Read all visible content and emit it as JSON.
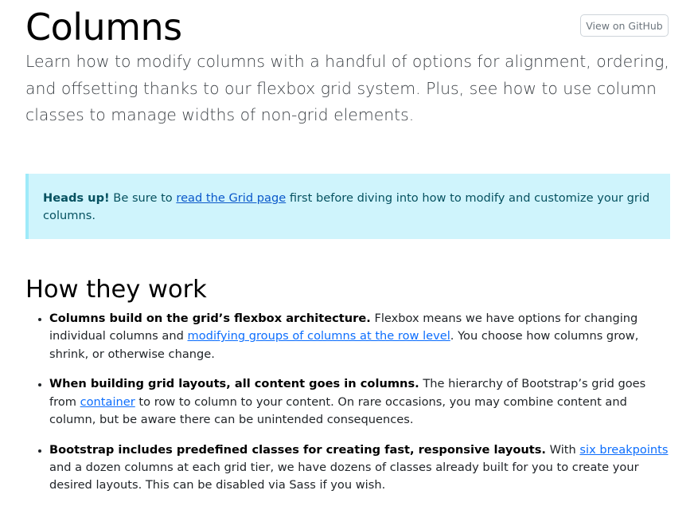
{
  "header": {
    "title": "Columns",
    "github_button": "View on GitHub",
    "lead": "Learn how to modify columns with a handful of options for alignment, ordering, and offsetting thanks to our flexbox grid system. Plus, see how to use column classes to manage widths of non-grid elements."
  },
  "callout": {
    "strong": "Heads up!",
    "text_before": " Be sure to ",
    "link": "read the Grid page",
    "text_after": " first before diving into how to modify and customize your grid columns."
  },
  "section": {
    "heading": "How they work",
    "items": [
      {
        "strong": "Columns build on the grid’s flexbox architecture.",
        "text_before": " Flexbox means we have options for changing individual columns and ",
        "link": "modifying groups of columns at the row level",
        "text_after": ". You choose how columns grow, shrink, or otherwise change."
      },
      {
        "strong": "When building grid layouts, all content goes in columns.",
        "text_before": " The hierarchy of Bootstrap’s grid goes from ",
        "link": "container",
        "text_after": " to row to column to your content. On rare occasions, you may combine content and column, but be aware there can be unintended consequences."
      },
      {
        "strong": "Bootstrap includes predefined classes for creating fast, responsive layouts.",
        "text_before": " With ",
        "link": "six breakpoints",
        "text_after": " and a dozen columns at each grid tier, we have dozens of classes already built for you to create your desired layouts. This can be disabled via Sass if you wish."
      }
    ]
  },
  "colors": {
    "callout_bg": "#cff4fc",
    "callout_border": "#9eeaf9",
    "link": "#0d6efd"
  }
}
